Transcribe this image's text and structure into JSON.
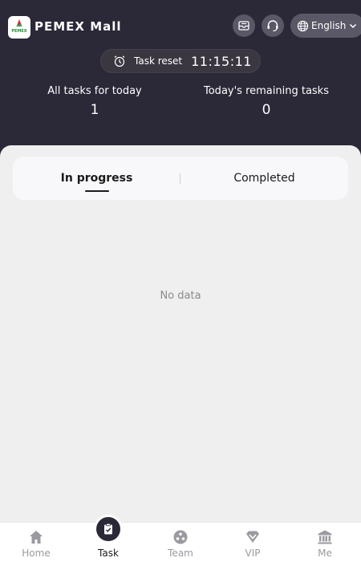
{
  "header": {
    "logo_text": "PEMEX",
    "title": "PEMEX Mall",
    "icons": [
      "mail-icon",
      "headset-icon",
      "globe-icon",
      "chevron-down-icon"
    ],
    "language": "English"
  },
  "reset": {
    "label": "Task reset",
    "timer": "11:15:11",
    "icon": "alarm-clock-icon"
  },
  "stats": {
    "all_label": "All tasks for today",
    "all_value": "1",
    "remaining_label": "Today's remaining tasks",
    "remaining_value": "0"
  },
  "tabs": [
    {
      "label": "In progress",
      "active": true
    },
    {
      "label": "Completed",
      "active": false
    }
  ],
  "empty_text": "No data",
  "nav": {
    "items": [
      {
        "label": "Home",
        "icon": "home-icon"
      },
      {
        "label": "Task",
        "icon": "clipboard-check-icon",
        "active": true
      },
      {
        "label": "Team",
        "icon": "team-icon"
      },
      {
        "label": "VIP",
        "icon": "diamond-icon"
      },
      {
        "label": "Me",
        "icon": "bank-icon"
      }
    ]
  },
  "colors": {
    "header_bg": "#2b2838",
    "panel_bg": "#efeff0",
    "nav_inactive": "#9a9aa0",
    "nav_active": "#1b1b1b"
  }
}
